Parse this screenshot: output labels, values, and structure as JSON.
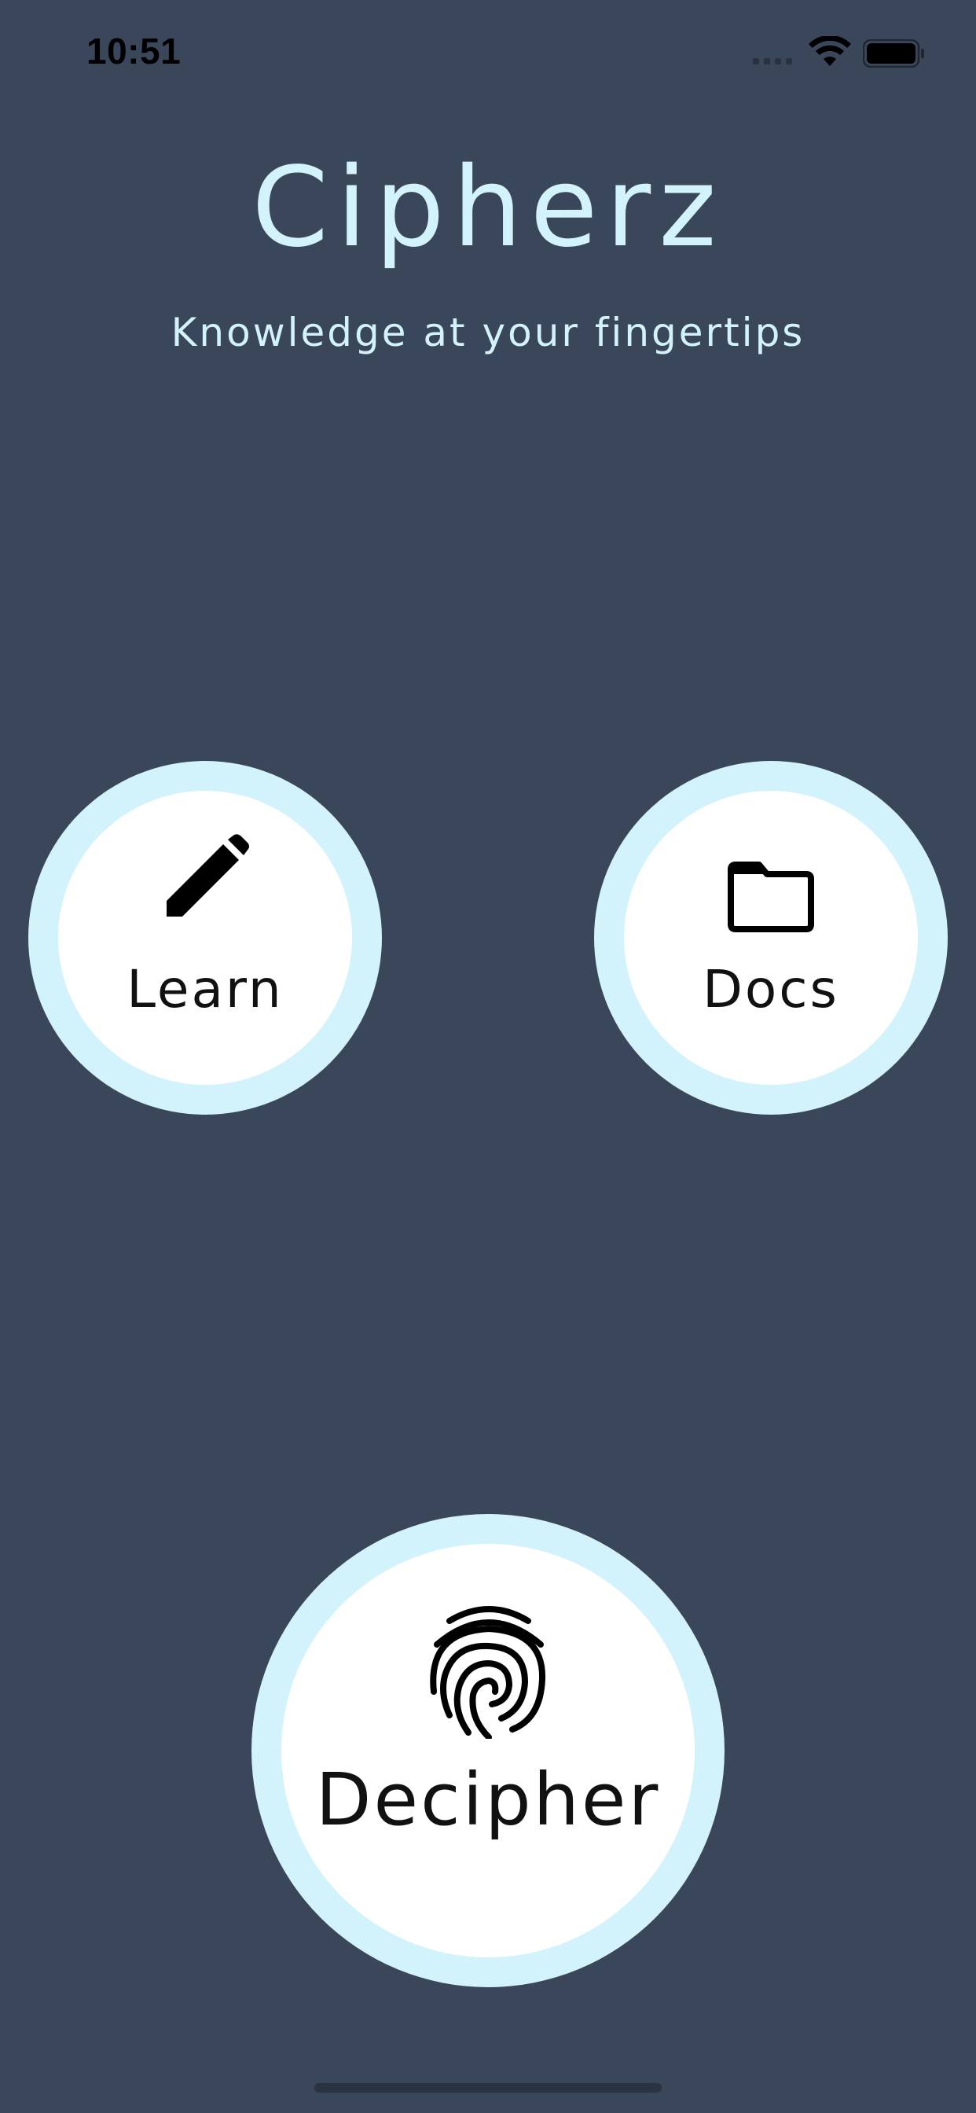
{
  "status_bar": {
    "time": "10:51"
  },
  "header": {
    "title": "Cipherz",
    "subtitle": "Knowledge at your fingertips"
  },
  "buttons": {
    "learn": {
      "label": "Learn",
      "icon": "pencil-icon"
    },
    "docs": {
      "label": "Docs",
      "icon": "folder-icon"
    },
    "decipher": {
      "label": "Decipher",
      "icon": "fingerprint-icon"
    }
  },
  "colors": {
    "background": "#3a4659",
    "accent": "#d2f3fb",
    "button_fill": "#ffffff",
    "button_text": "#111111"
  }
}
